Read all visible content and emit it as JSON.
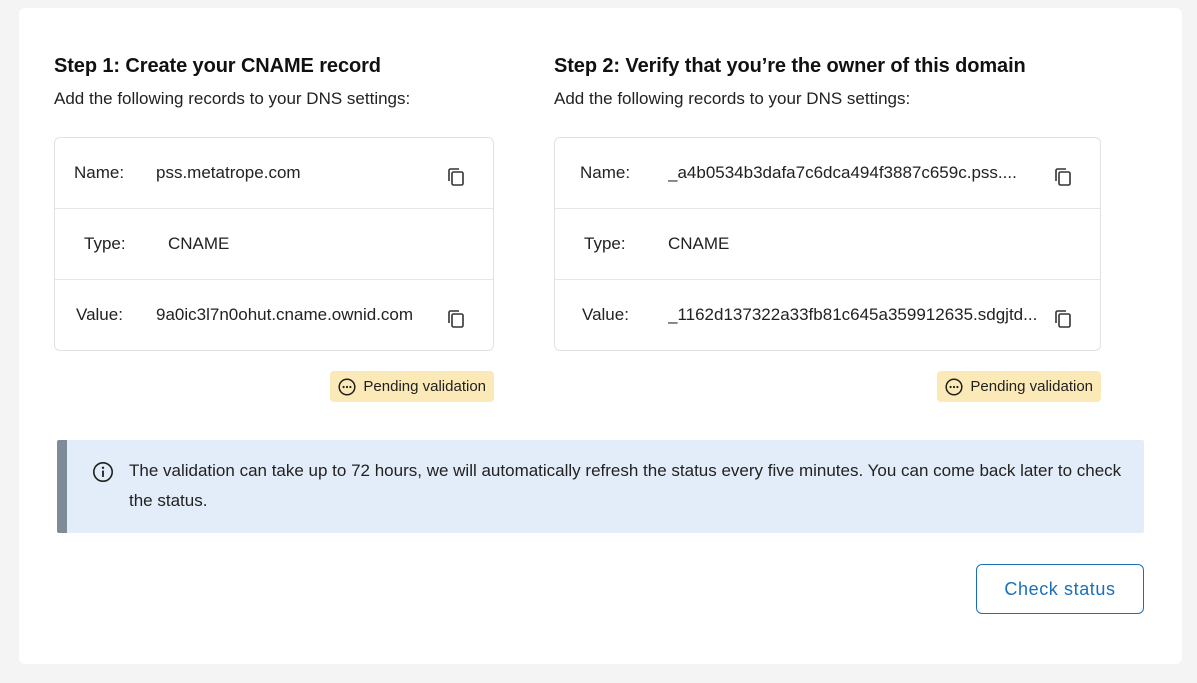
{
  "step1": {
    "title": "Step 1: Create your CNAME record",
    "subtitle": "Add the following records to your DNS settings:",
    "name_label": "Name:",
    "name_value": "pss.metatrope.com",
    "type_label": "Type:",
    "type_value": "CNAME",
    "value_label": "Value:",
    "value_value": "9a0ic3l7n0ohut.cname.ownid.com",
    "status": "Pending validation"
  },
  "step2": {
    "title": "Step 2: Verify that you’re the owner of this domain",
    "subtitle": "Add the following records to your DNS settings:",
    "name_label": "Name:",
    "name_value": "_a4b0534b3dafa7c6dca494f3887c659c.pss....",
    "type_label": "Type:",
    "type_value": "CNAME",
    "value_label": "Value:",
    "value_value": "_1162d137322a33fb81c645a359912635.sdgjtd...",
    "status": "Pending validation"
  },
  "info": {
    "icon": "info-icon",
    "text": "The validation can take up to 72 hours, we will automatically refresh the status every five minutes. You can come back later to check the status."
  },
  "actions": {
    "check_status_label": "Check status"
  },
  "colors": {
    "accent": "#1a6fb8",
    "pending_badge": "#fbe9b7",
    "info_bg": "#e3edf9",
    "info_border": "#7e8c99"
  }
}
